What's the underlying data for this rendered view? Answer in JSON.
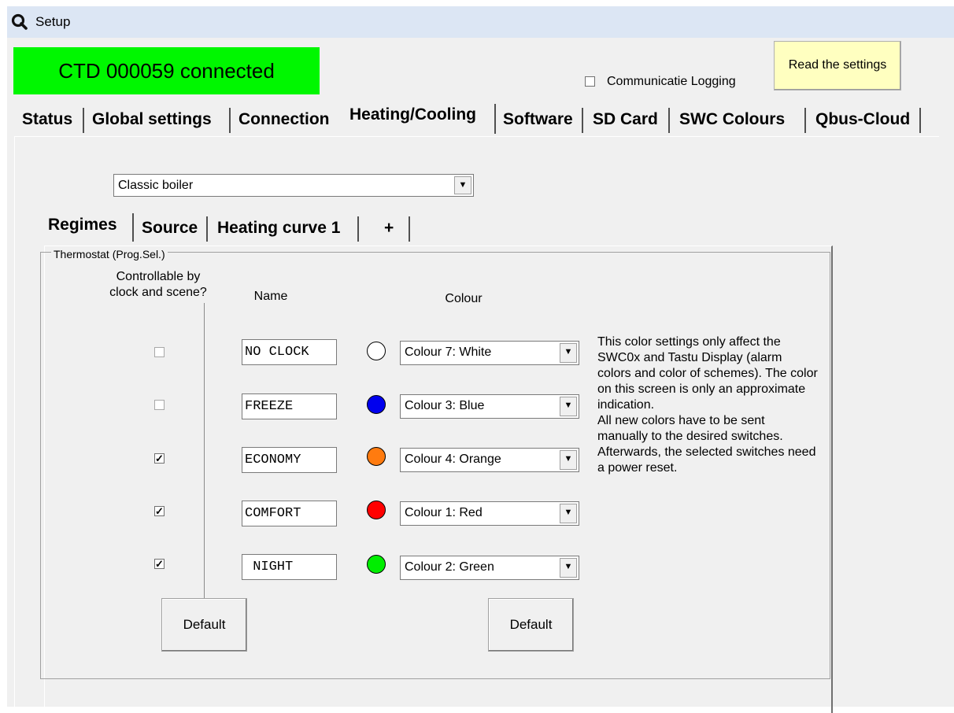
{
  "window": {
    "title": "Setup",
    "icon": "search-icon"
  },
  "header": {
    "connection_status": "CTD 000059 connected",
    "status_color": "#00f700",
    "logging_label": "Communicatie Logging",
    "logging_checked": false,
    "read_button": "Read the settings"
  },
  "tabs": [
    {
      "label": "Status"
    },
    {
      "label": "Global settings"
    },
    {
      "label": "Connection"
    },
    {
      "label": "Heating/Cooling",
      "active": true
    },
    {
      "label": "Software"
    },
    {
      "label": "SD Card"
    },
    {
      "label": "SWC Colours"
    },
    {
      "label": "Qbus-Cloud"
    }
  ],
  "system_type": {
    "value": "Classic boiler"
  },
  "subtabs": [
    {
      "label": "Regimes",
      "active": true
    },
    {
      "label": "Source"
    },
    {
      "label": "Heating curve 1"
    },
    {
      "label": "+"
    }
  ],
  "group": {
    "title": "Thermostat (Prog.Sel.)",
    "col_controllable": "Controllable by clock and scene?",
    "col_name": "Name",
    "col_colour": "Colour"
  },
  "regimes": [
    {
      "controllable": false,
      "name": "NO CLOCK",
      "colour_label": "Colour 7: White",
      "colour_hex": "#ffffff"
    },
    {
      "controllable": false,
      "name": "FREEZE",
      "colour_label": "Colour 3: Blue",
      "colour_hex": "#0000ee"
    },
    {
      "controllable": true,
      "name": "ECONOMY",
      "colour_label": "Colour 4: Orange",
      "colour_hex": "#ff7b0f"
    },
    {
      "controllable": true,
      "name": "COMFORT",
      "colour_label": "Colour 1: Red",
      "colour_hex": "#ff0000"
    },
    {
      "controllable": true,
      "name": " NIGHT",
      "colour_label": "Colour 2: Green",
      "colour_hex": "#00ee00"
    }
  ],
  "info_text": "This color settings only affect the SWC0x and Tastu Display (alarm colors and color of schemes). The color on this screen is only an approximate indication.\nAll new colors have to be sent manually to the desired switches. Afterwards, the selected switches need a power reset.",
  "buttons": {
    "default_left": "Default",
    "default_right": "Default"
  }
}
